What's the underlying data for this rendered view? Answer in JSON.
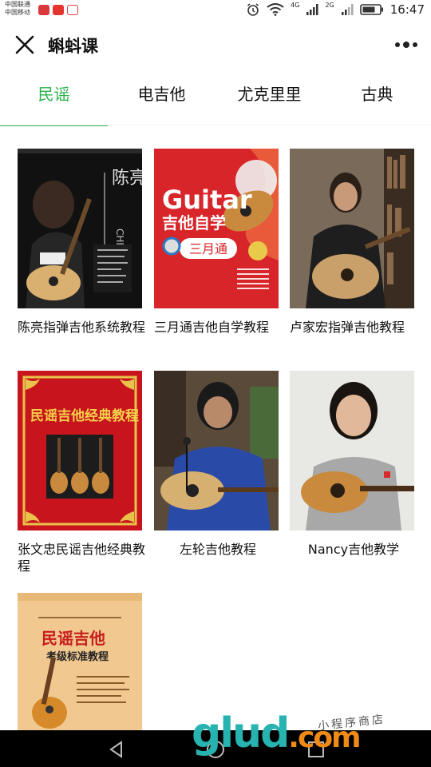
{
  "status_bar": {
    "carrier_1": "中国联通",
    "carrier_2": "中国移动",
    "net_1": "4G",
    "net_2": "2G",
    "time": "16:47"
  },
  "title_bar": {
    "title": "蝌蚪课"
  },
  "tabs": [
    {
      "label": "民谣",
      "active": true
    },
    {
      "label": "电吉他",
      "active": false
    },
    {
      "label": "尤克里里",
      "active": false
    },
    {
      "label": "古典",
      "active": false
    }
  ],
  "courses": [
    {
      "title": "陈亮指弹吉他系统教程",
      "cover_text": "陈亮",
      "cover_sub": "CHEN LIANG"
    },
    {
      "title": "三月通吉他自学教程",
      "cover_text": "Guitar",
      "cover_sub": "吉他自学",
      "cover_sub2": "三月通"
    },
    {
      "title": "卢家宏指弹吉他教程"
    },
    {
      "title": "张文忠民谣吉他经典教程",
      "cover_text": "民谣吉他经典教程"
    },
    {
      "title": "左轮吉他教程"
    },
    {
      "title": "Nancy吉他教学"
    },
    {
      "title": "",
      "cover_text": "民谣吉他",
      "cover_sub": "考级标准教程"
    }
  ],
  "watermark": {
    "main": "glud",
    "tld": ".com",
    "small": "小程序商店"
  },
  "colors": {
    "accent": "#2bb24c",
    "nav": "#000000"
  }
}
